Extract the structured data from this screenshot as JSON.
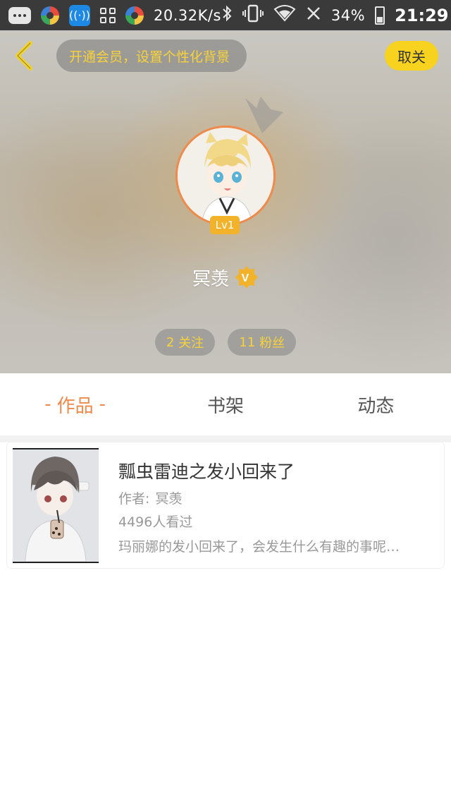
{
  "status_bar": {
    "network_speed": "20.32K/s",
    "battery": "34%",
    "time": "21:29",
    "icons": [
      "chat-icon",
      "color-ball-icon",
      "signal-app-icon",
      "grid-icon",
      "color-ball-icon",
      "bluetooth-icon",
      "vibrate-icon",
      "wifi-icon",
      "no-signal-icon",
      "battery-icon"
    ]
  },
  "header": {
    "vip_banner": "开通会员，设置个性化背景",
    "unfollow_label": "取关"
  },
  "profile": {
    "level": "Lv1",
    "name": "冥羡",
    "verified_mark": "V",
    "following_count": "2",
    "following_label": "关注",
    "followers_count": "11",
    "followers_label": "粉丝"
  },
  "tabs": {
    "dash": "-",
    "items": [
      {
        "label": "作品"
      },
      {
        "label": "书架"
      },
      {
        "label": "动态"
      }
    ]
  },
  "books": [
    {
      "title": "瓢虫雷迪之发小回来了",
      "author_label": "作者:",
      "author": "冥羡",
      "views": "4496人看过",
      "description": "玛丽娜的发小回来了，会发生什么有趣的事呢…"
    }
  ],
  "colors": {
    "accent_orange": "#f08a4b",
    "accent_yellow": "#f7d21e",
    "text_gold": "#f6d23b"
  }
}
